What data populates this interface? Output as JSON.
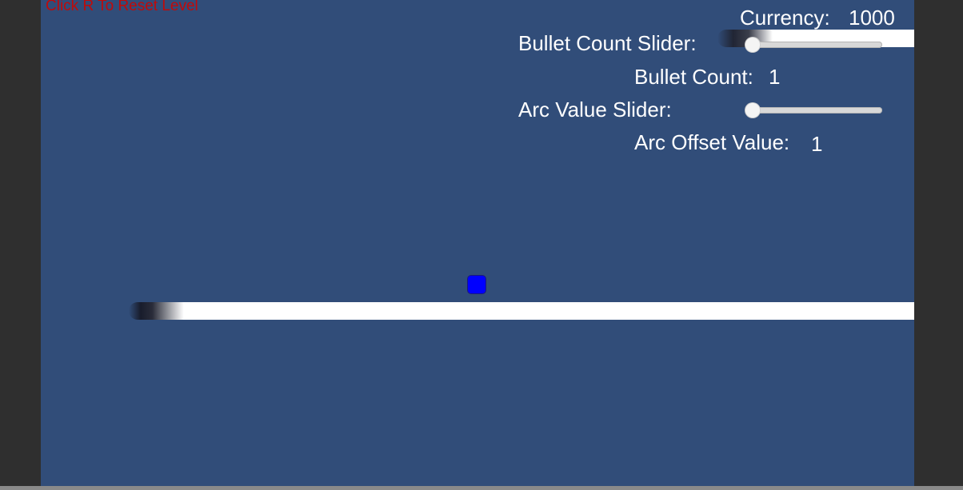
{
  "hud": {
    "reset_hint": "Click R To Reset Level",
    "currency_label": "Currency:",
    "currency_value": "1000",
    "bullet_count_slider_label": "Bullet Count Slider:",
    "bullet_count_label": "Bullet Count:",
    "bullet_count_value": "1",
    "arc_value_slider_label": "Arc Value Slider:",
    "arc_offset_label": "Arc Offset Value:",
    "arc_offset_value": "1"
  },
  "sliders": {
    "bullet_count": {
      "value_fraction": 0.0
    },
    "arc_value": {
      "value_fraction": 0.0
    }
  },
  "colors": {
    "background": "#314d79",
    "reset_hint": "#c00a0a",
    "hud_text": "#ffffff",
    "player": "#0000ff"
  }
}
